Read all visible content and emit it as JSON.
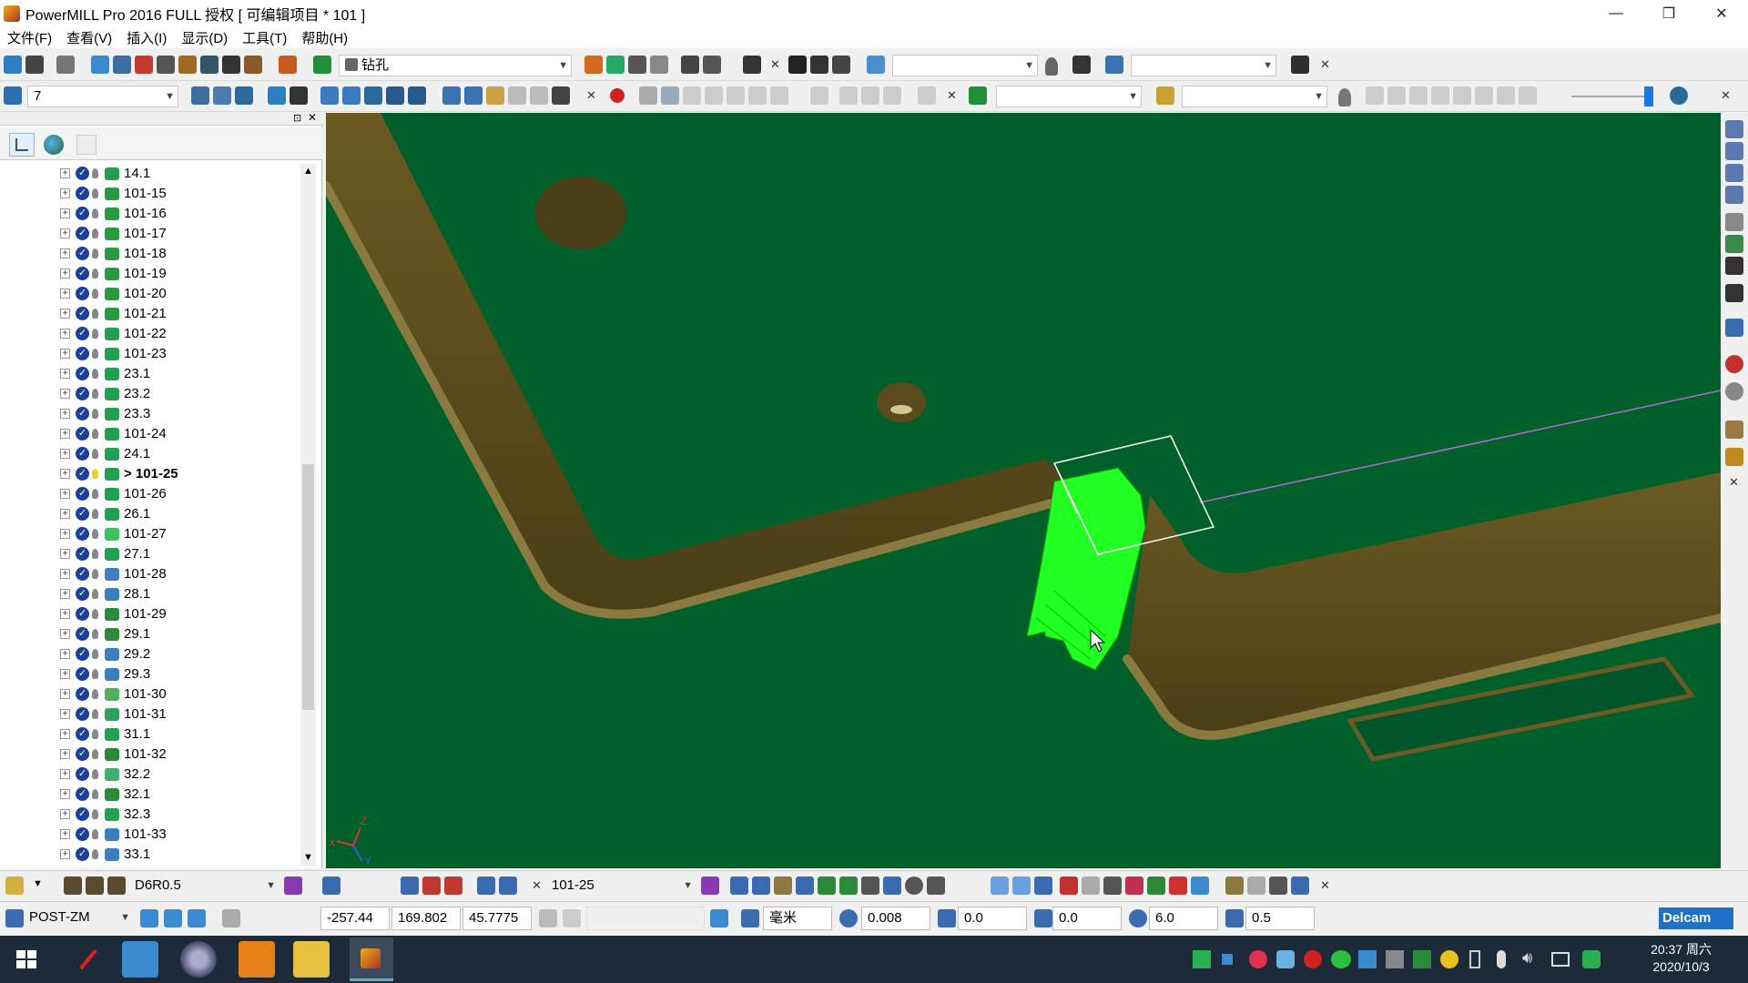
{
  "window": {
    "title": "PowerMILL Pro 2016 FULL 授权   [ 可编辑项目 * 101 ]",
    "minimize": "—",
    "restore": "❐",
    "close": "✕"
  },
  "menu": [
    "文件(F)",
    "查看(V)",
    "插入(I)",
    "显示(D)",
    "工具(T)",
    "帮助(H)"
  ],
  "toolbar1": {
    "strategy_combo": "钻孔"
  },
  "toolbar2": {
    "workplane_combo": "7"
  },
  "explorer": {
    "active_index": 15,
    "items": [
      "14.1",
      "101-15",
      "101-16",
      "101-17",
      "101-18",
      "101-19",
      "101-20",
      "101-21",
      "101-22",
      "101-23",
      "23.1",
      "23.2",
      "23.3",
      "101-24",
      "24.1",
      "> 101-25",
      "101-26",
      "26.1",
      "101-27",
      "27.1",
      "101-28",
      "28.1",
      "101-29",
      "29.1",
      "29.2",
      "29.3",
      "101-30",
      "101-31",
      "31.1",
      "101-32",
      "32.2",
      "32.1",
      "32.3",
      "101-33",
      "33.1"
    ]
  },
  "viewport": {
    "axis_x": "x",
    "axis_y": "Y",
    "axis_z": "Z",
    "background_color": "#00602a",
    "highlight_color": "#22ff22"
  },
  "bottom1": {
    "tool_combo": "D6R0.5",
    "toolpath_combo": "101-25"
  },
  "bottom2": {
    "post_combo": "POST-ZM",
    "coord_x": "-257.44",
    "coord_y": "169.802",
    "coord_z": "45.7775",
    "units": "毫米",
    "tolerance": "0.008",
    "thickness": "0.0",
    "axial_thickness": "0.0",
    "diameter": "6.0",
    "stepover": "0.5",
    "brand": "Delcam"
  },
  "taskbar": {
    "time": "20:37 周六",
    "date": "2020/10/3"
  }
}
